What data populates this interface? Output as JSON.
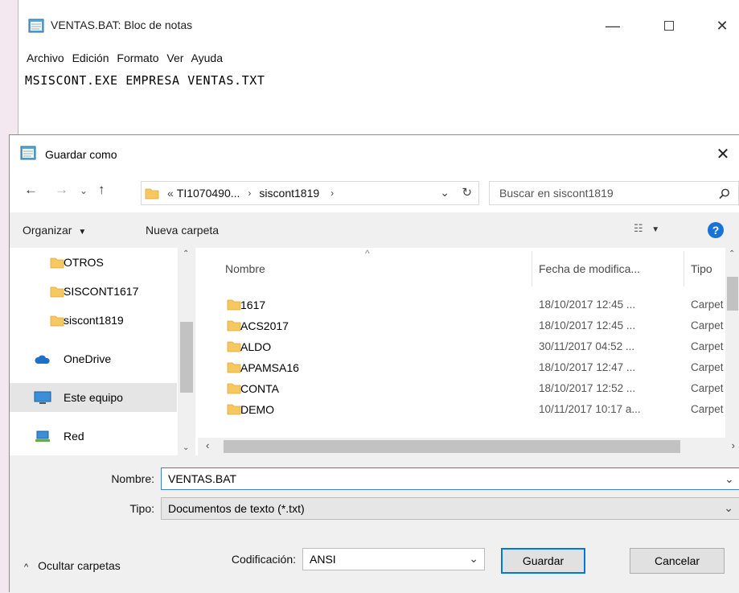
{
  "notepad": {
    "title": "VENTAS.BAT: Bloc de notas",
    "menu": [
      "Archivo",
      "Edición",
      "Formato",
      "Ver",
      "Ayuda"
    ],
    "content": "MSISCONT.EXE EMPRESA VENTAS.TXT"
  },
  "dialog": {
    "title": "Guardar como",
    "breadcrumb": {
      "overflow": "«",
      "segments": [
        "TI1070490...",
        "siscont1819"
      ]
    },
    "search_placeholder": "Buscar en siscont1819",
    "toolbar": {
      "organize": "Organizar",
      "new_folder": "Nueva carpeta"
    },
    "nav_items": [
      {
        "label": "OTROS",
        "icon": "folder-icon"
      },
      {
        "label": "SISCONT1617",
        "icon": "folder-icon"
      },
      {
        "label": "siscont1819",
        "icon": "folder-icon"
      },
      {
        "label": "OneDrive",
        "icon": "cloud-icon"
      },
      {
        "label": "Este equipo",
        "icon": "computer-icon"
      },
      {
        "label": "Red",
        "icon": "network-icon"
      }
    ],
    "columns": [
      "Nombre",
      "Fecha de modifica...",
      "Tipo"
    ],
    "files": [
      {
        "name": "1617",
        "date": "18/10/2017 12:45 ...",
        "type": "Carpet"
      },
      {
        "name": "ACS2017",
        "date": "18/10/2017 12:45 ...",
        "type": "Carpet"
      },
      {
        "name": "ALDO",
        "date": "30/11/2017 04:52 ...",
        "type": "Carpet"
      },
      {
        "name": "APAMSA16",
        "date": "18/10/2017 12:47 ...",
        "type": "Carpet"
      },
      {
        "name": "CONTA",
        "date": "18/10/2017 12:52 ...",
        "type": "Carpet"
      },
      {
        "name": "DEMO",
        "date": "10/11/2017 10:17 a...",
        "type": "Carpet"
      }
    ],
    "filename_label": "Nombre:",
    "filename_value": "VENTAS.BAT",
    "filetype_label": "Tipo:",
    "filetype_value": "Documentos de texto (*.txt)",
    "encoding_label": "Codificación:",
    "encoding_value": "ANSI",
    "save_label": "Guardar",
    "cancel_label": "Cancelar",
    "hide_folders_label": "Ocultar carpetas"
  },
  "colors": {
    "folder": "#f7c860",
    "selection": "#cce8ff",
    "accent": "#0078d7"
  }
}
